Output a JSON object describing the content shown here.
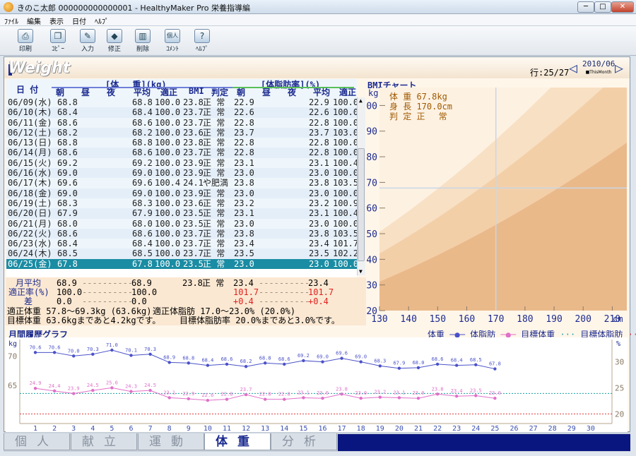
{
  "window": {
    "title": "きのこ太郎 000000000000001 - HealthyMaker Pro 栄養指導編",
    "min": "─",
    "max": "□",
    "close": "✕"
  },
  "menu": [
    "ﾌｧｲﾙ",
    "編集",
    "表示",
    "日付",
    "ﾍﾙﾌﾟ"
  ],
  "toolbar": [
    {
      "label": "印刷",
      "icon": "printer-icon",
      "glyph": "⎙"
    },
    {
      "label": "ｺﾋﾟｰ",
      "icon": "copy-icon",
      "glyph": "❐"
    },
    {
      "label": "入力",
      "icon": "input-icon",
      "glyph": "✎"
    },
    {
      "label": "修正",
      "icon": "edit-icon",
      "glyph": "◆"
    },
    {
      "label": "削除",
      "icon": "trash-icon",
      "glyph": "▥"
    },
    {
      "label": "ｺﾒﾝﾄ",
      "icon": "comment-icon",
      "glyph": "個人"
    },
    {
      "label": "ﾍﾙﾌﾟ",
      "icon": "help-icon",
      "glyph": "?"
    }
  ],
  "page": {
    "title": "Weight",
    "row_info": "行:25/27",
    "month": "2010/06",
    "this_month": "■ThisMonth"
  },
  "grid": {
    "group_weight": "[体　 重](kg)",
    "group_fat": "[体脂肪率](%)",
    "date_header": "日 付",
    "weight_cols": [
      "朝",
      "昼",
      "夜",
      "平均",
      "適正",
      "BMI",
      "判定"
    ],
    "fat_cols": [
      "朝",
      "昼",
      "夜",
      "平均",
      "適正"
    ],
    "rows": [
      [
        "06/09(水)",
        "68.8",
        "",
        "",
        "68.8",
        "100.0",
        "23.8",
        "正 常",
        "22.9",
        "",
        "",
        "22.9",
        "100.0"
      ],
      [
        "06/10(木)",
        "68.4",
        "",
        "",
        "68.4",
        "100.0",
        "23.7",
        "正 常",
        "22.6",
        "",
        "",
        "22.6",
        "100.0"
      ],
      [
        "06/11(金)",
        "68.6",
        "",
        "",
        "68.6",
        "100.0",
        "23.7",
        "正 常",
        "22.8",
        "",
        "",
        "22.8",
        "100.0"
      ],
      [
        "06/12(土)",
        "68.2",
        "",
        "",
        "68.2",
        "100.0",
        "23.6",
        "正 常",
        "23.7",
        "",
        "",
        "23.7",
        "103.0"
      ],
      [
        "06/13(日)",
        "68.8",
        "",
        "",
        "68.8",
        "100.0",
        "23.8",
        "正 常",
        "22.8",
        "",
        "",
        "22.8",
        "100.0"
      ],
      [
        "06/14(月)",
        "68.6",
        "",
        "",
        "68.6",
        "100.0",
        "23.7",
        "正 常",
        "22.8",
        "",
        "",
        "22.8",
        "100.0"
      ],
      [
        "06/15(火)",
        "69.2",
        "",
        "",
        "69.2",
        "100.0",
        "23.9",
        "正 常",
        "23.1",
        "",
        "",
        "23.1",
        "100.4"
      ],
      [
        "06/16(水)",
        "69.0",
        "",
        "",
        "69.0",
        "100.0",
        "23.9",
        "正 常",
        "23.0",
        "",
        "",
        "23.0",
        "100.0"
      ],
      [
        "06/17(木)",
        "69.6",
        "",
        "",
        "69.6",
        "100.4",
        "24.1",
        "や肥満",
        "23.8",
        "",
        "",
        "23.8",
        "103.5"
      ],
      [
        "06/18(金)",
        "69.0",
        "",
        "",
        "69.0",
        "100.0",
        "23.9",
        "正 常",
        "23.0",
        "",
        "",
        "23.0",
        "100.0"
      ],
      [
        "06/19(土)",
        "68.3",
        "",
        "",
        "68.3",
        "100.0",
        "23.6",
        "正 常",
        "23.2",
        "",
        "",
        "23.2",
        "100.9"
      ],
      [
        "06/20(日)",
        "67.9",
        "",
        "",
        "67.9",
        "100.0",
        "23.5",
        "正 常",
        "23.1",
        "",
        "",
        "23.1",
        "100.4"
      ],
      [
        "06/21(月)",
        "68.0",
        "",
        "",
        "68.0",
        "100.0",
        "23.5",
        "正 常",
        "23.0",
        "",
        "",
        "23.0",
        "100.0"
      ],
      [
        "06/22(火)",
        "68.6",
        "",
        "",
        "68.6",
        "100.0",
        "23.7",
        "正 常",
        "23.8",
        "",
        "",
        "23.8",
        "103.5"
      ],
      [
        "06/23(水)",
        "68.4",
        "",
        "",
        "68.4",
        "100.0",
        "23.7",
        "正 常",
        "23.4",
        "",
        "",
        "23.4",
        "101.7"
      ],
      [
        "06/24(木)",
        "68.5",
        "",
        "",
        "68.5",
        "100.0",
        "23.7",
        "正 常",
        "23.5",
        "",
        "",
        "23.5",
        "102.2"
      ],
      [
        "06/25(金)",
        "67.8",
        "",
        "",
        "67.8",
        "100.0",
        "23.5",
        "正 常",
        "23.0",
        "",
        "",
        "23.0",
        "100.0"
      ]
    ],
    "selected_row": 16
  },
  "summary": {
    "avg_label": "月平均",
    "avg": [
      "68.9",
      "-----",
      "-----",
      "68.9",
      "",
      "23.8",
      "正 常",
      "23.4",
      "-----",
      "-----",
      "23.4",
      ""
    ],
    "rate_label": "適正率(%)",
    "rate": [
      "100.0",
      "-----",
      "-----",
      "100.0",
      "",
      "",
      "",
      "101.7",
      "-----",
      "-----",
      "101.7",
      ""
    ],
    "diff_label": "差",
    "diff": [
      "0.0",
      "-----",
      "-----",
      "0.0",
      "",
      "",
      "",
      "+0.4",
      "-----",
      "-----",
      "+0.4",
      ""
    ],
    "line1a": "適正体重 57.8～69.3kg (63.6kg)",
    "line1b": "適正体脂肪 17.0～23.0% (20.0%)",
    "line2a": "目標体重 63.6kgまであと4.2kgです。",
    "line2b": "目標体脂肪率 20.0%まであと3.0%です。"
  },
  "bmi": {
    "title": "BMIチャート",
    "unit_y": "kg",
    "unit_x": "cm",
    "info": [
      "体 重 67.8kg",
      "身 長 170.0cm",
      "判 定 正　 常"
    ],
    "yticks": [
      "100",
      "90",
      "80",
      "70",
      "60",
      "50",
      "40",
      "30",
      "20"
    ],
    "xticks": [
      "130",
      "140",
      "150",
      "160",
      "170",
      "180",
      "190",
      "200",
      "210"
    ],
    "height_cm": 170,
    "weight_kg": 67.8,
    "colors": {
      "bg": "#fdf1e2",
      "band1": "#f8e0c4",
      "band2": "#f3cfa8",
      "band3": "#eab98a",
      "grid": "#c9d6e6"
    }
  },
  "history": {
    "title": "月間履歴グラフ",
    "legend": [
      "体重",
      "体脂肪",
      "目標体重",
      "目標体脂肪"
    ],
    "unit_left": "kg",
    "unit_right": "%",
    "left_ticks": [
      "70",
      "65"
    ],
    "right_ticks": [
      "30",
      "25",
      "20"
    ],
    "days": [
      "1",
      "2",
      "3",
      "4",
      "5",
      "6",
      "7",
      "8",
      "9",
      "10",
      "11",
      "12",
      "13",
      "14",
      "15",
      "16",
      "17",
      "18",
      "19",
      "20",
      "21",
      "22",
      "23",
      "24",
      "25",
      "26",
      "27",
      "28",
      "29",
      "30"
    ],
    "chart_data": {
      "type": "line",
      "x": [
        1,
        2,
        3,
        4,
        5,
        6,
        7,
        8,
        9,
        10,
        11,
        12,
        13,
        14,
        15,
        16,
        17,
        18,
        19,
        20,
        21,
        22,
        23,
        24,
        25
      ],
      "series": [
        {
          "name": "体重",
          "values": [
            70.6,
            70.6,
            70.0,
            70.3,
            71.0,
            70.1,
            70.3,
            68.9,
            68.8,
            68.4,
            68.6,
            68.2,
            68.8,
            68.6,
            69.2,
            69.0,
            69.6,
            69.0,
            68.3,
            67.9,
            68.0,
            68.6,
            68.4,
            68.5,
            67.8
          ],
          "color": "#4a52c8"
        },
        {
          "name": "体脂肪",
          "values": [
            24.9,
            24.4,
            23.9,
            24.5,
            25.0,
            24.3,
            24.5,
            23.1,
            22.9,
            22.6,
            22.8,
            23.7,
            22.8,
            22.8,
            23.1,
            23.0,
            23.8,
            23.0,
            23.2,
            23.1,
            23.0,
            23.8,
            23.4,
            23.5,
            23.0
          ],
          "color": "#e070c8"
        },
        {
          "name": "目標体重",
          "constant": 63.6,
          "color": "#1aa0a0"
        },
        {
          "name": "目標体脂肪",
          "constant": 20.0,
          "color": "#e03a3a"
        }
      ]
    }
  },
  "tabs": [
    "個人",
    "献立",
    "運動",
    "体重",
    "分析"
  ],
  "active_tab": 3
}
